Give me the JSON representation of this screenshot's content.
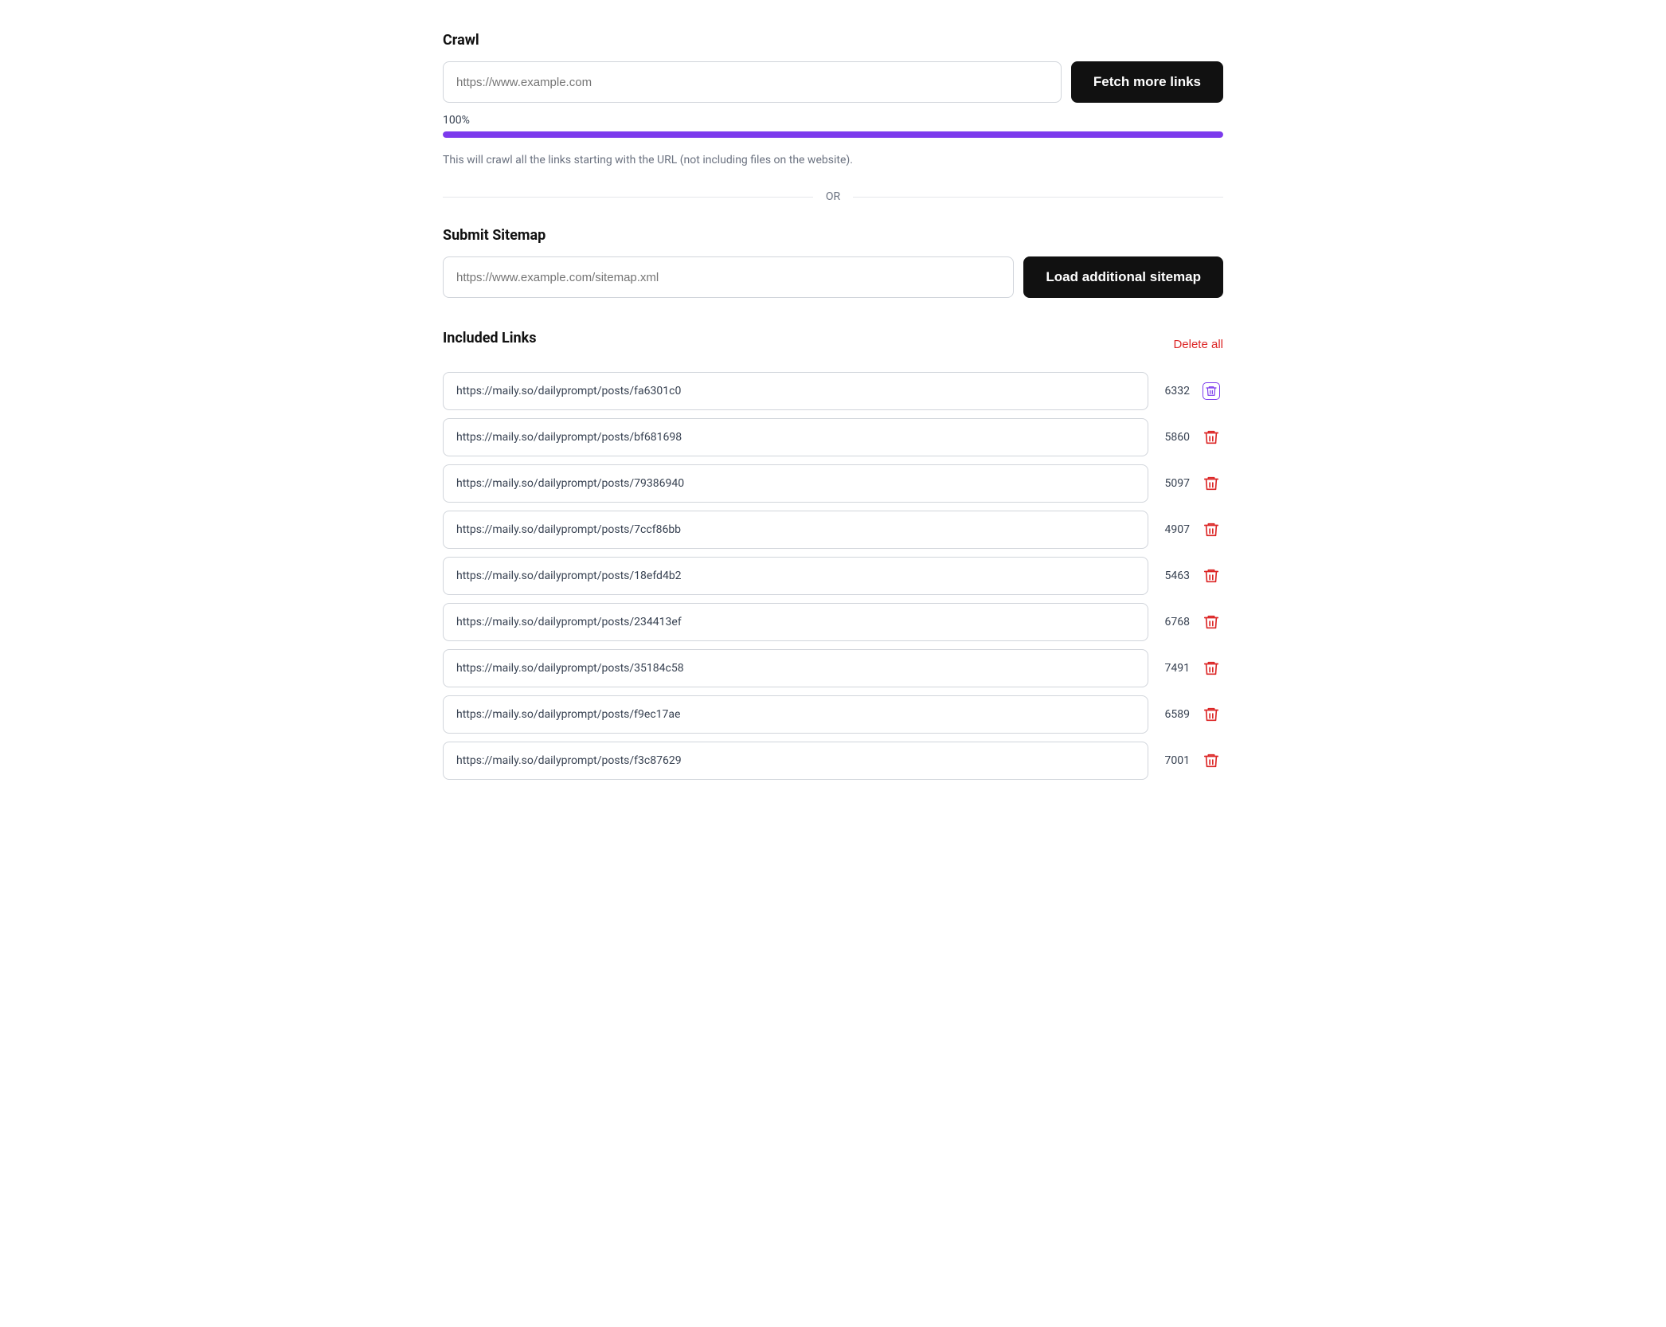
{
  "crawl": {
    "section_title": "Crawl",
    "input_placeholder": "https://www.example.com",
    "fetch_button_label": "Fetch more links",
    "progress_percent": "100%",
    "progress_value": 100,
    "description": "This will crawl all the links starting with the URL (not including files on the website)."
  },
  "or_divider": "OR",
  "sitemap": {
    "section_title": "Submit Sitemap",
    "input_placeholder": "https://www.example.com/sitemap.xml",
    "load_button_label": "Load additional sitemap"
  },
  "included_links": {
    "section_title": "Included Links",
    "delete_all_label": "Delete all",
    "links": [
      {
        "url": "https://maily.so/dailyprompt/posts/fa6301c0",
        "count": "6332",
        "highlighted": true
      },
      {
        "url": "https://maily.so/dailyprompt/posts/bf681698",
        "count": "5860",
        "highlighted": false
      },
      {
        "url": "https://maily.so/dailyprompt/posts/79386940",
        "count": "5097",
        "highlighted": false
      },
      {
        "url": "https://maily.so/dailyprompt/posts/7ccf86bb",
        "count": "4907",
        "highlighted": false
      },
      {
        "url": "https://maily.so/dailyprompt/posts/18efd4b2",
        "count": "5463",
        "highlighted": false
      },
      {
        "url": "https://maily.so/dailyprompt/posts/234413ef",
        "count": "6768",
        "highlighted": false
      },
      {
        "url": "https://maily.so/dailyprompt/posts/35184c58",
        "count": "7491",
        "highlighted": false
      },
      {
        "url": "https://maily.so/dailyprompt/posts/f9ec17ae",
        "count": "6589",
        "highlighted": false
      },
      {
        "url": "https://maily.so/dailyprompt/posts/f3c87629",
        "count": "7001",
        "highlighted": false
      }
    ]
  },
  "colors": {
    "progress_fill": "#7c3aed",
    "delete_all": "#dc2626",
    "trash_highlight": "#7c3aed",
    "trash_normal": "#dc2626"
  }
}
